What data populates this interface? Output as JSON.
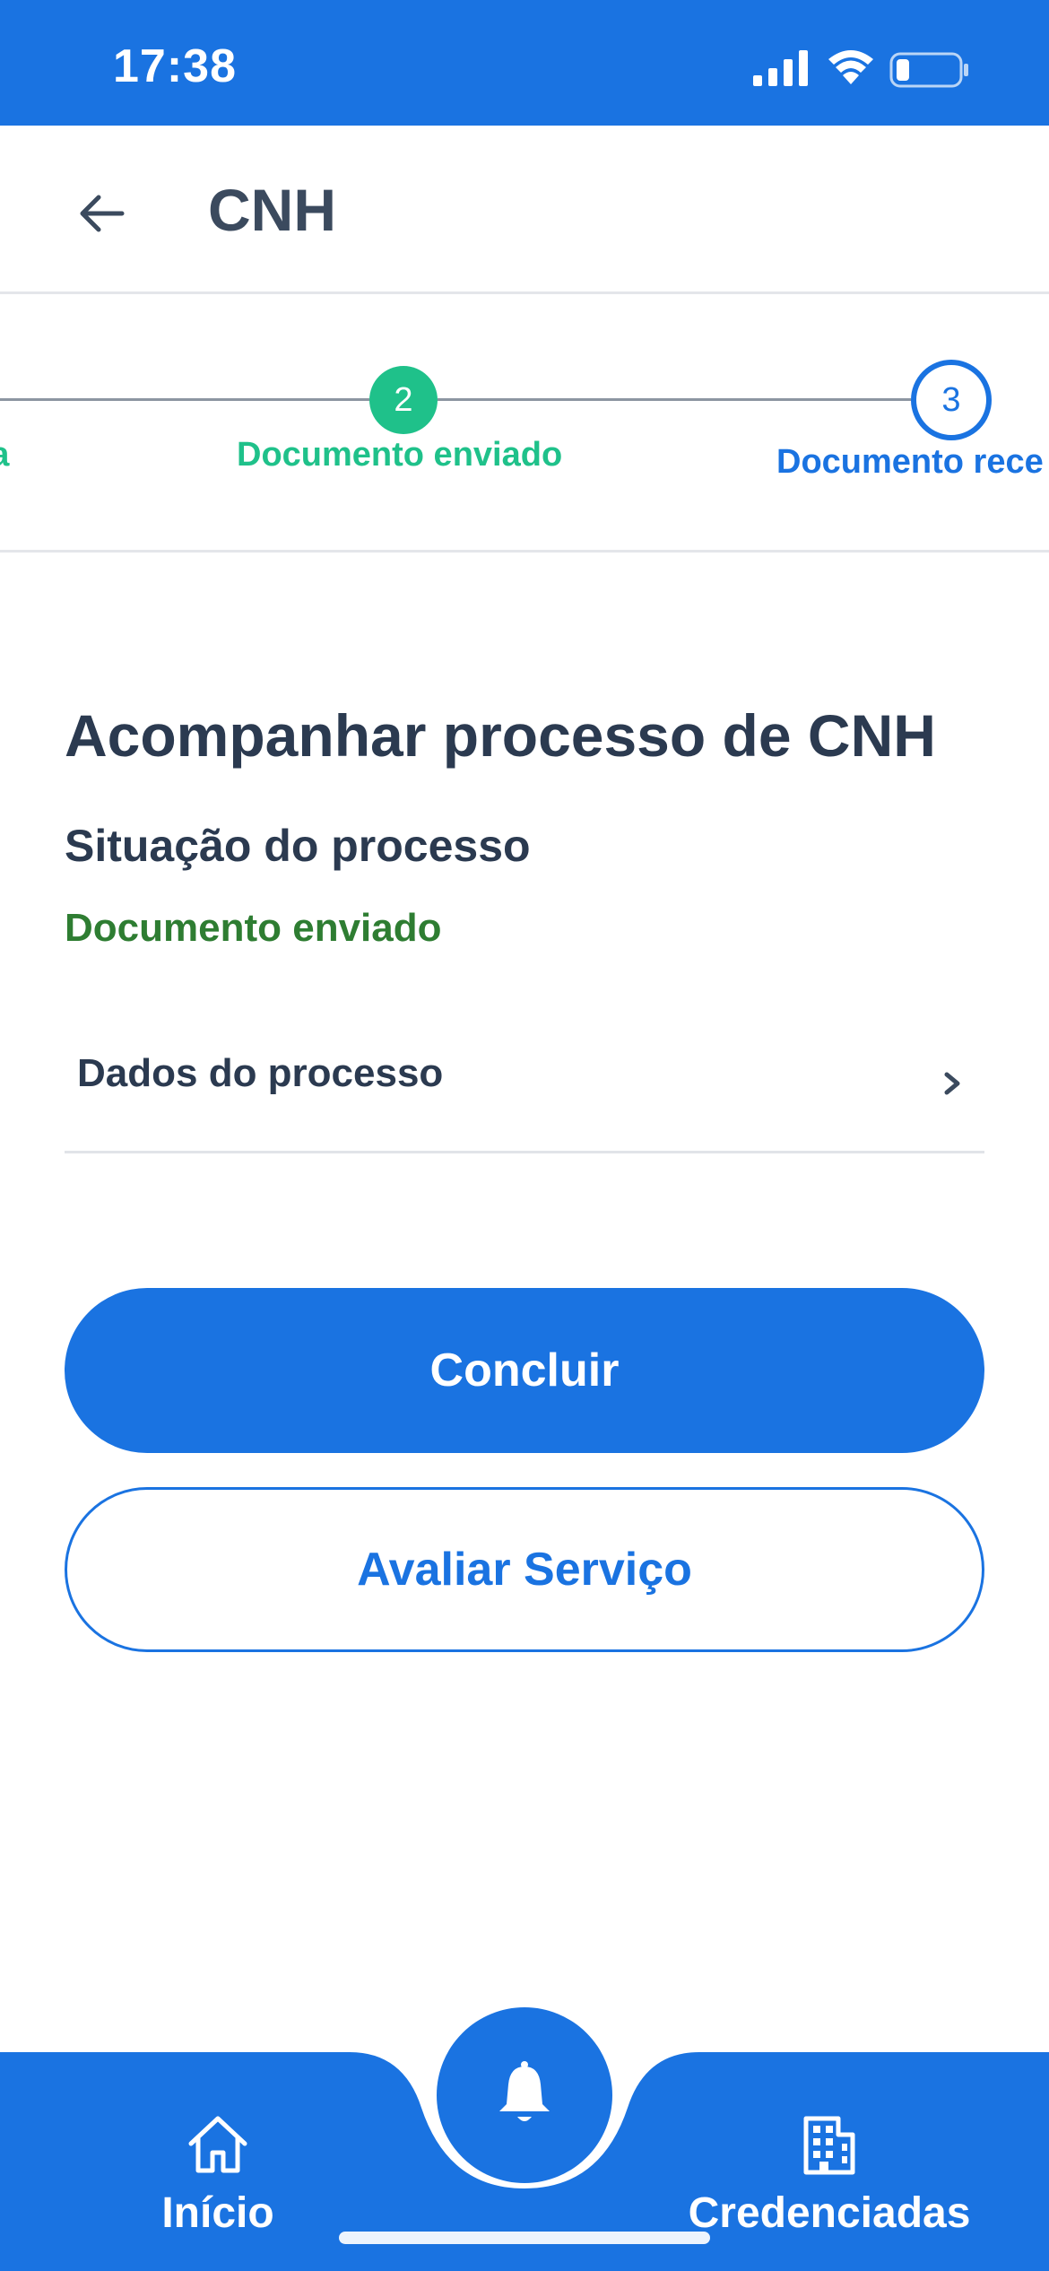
{
  "status_bar": {
    "time": "17:38",
    "icons": [
      "signal-icon",
      "wifi-icon",
      "battery-icon"
    ]
  },
  "header": {
    "back_icon": "arrow-left-icon",
    "title": "CNH"
  },
  "stepper": {
    "steps": [
      {
        "number": "",
        "label": "da",
        "state": "completed"
      },
      {
        "number": "2",
        "label": "Documento enviado",
        "state": "completed"
      },
      {
        "number": "3",
        "label": "Documento rece",
        "state": "current"
      }
    ]
  },
  "content": {
    "title": "Acompanhar processo de CNH",
    "status_heading": "Situação do processo",
    "status_value": "Documento enviado",
    "details_row": {
      "label": "Dados do processo",
      "icon": "chevron-right-icon"
    }
  },
  "actions": {
    "primary_label": "Concluir",
    "secondary_label": "Avaliar Serviço"
  },
  "bottom_nav": {
    "items": [
      {
        "label": "Início",
        "icon": "home-icon"
      },
      {
        "label": "Credenciadas",
        "icon": "building-icon"
      }
    ],
    "fab_icon": "bell-icon"
  },
  "colors": {
    "primary": "#1a73e1",
    "step_done": "#1fc18a",
    "status_green": "#2e7d32",
    "text_dark": "#2b3a50"
  }
}
